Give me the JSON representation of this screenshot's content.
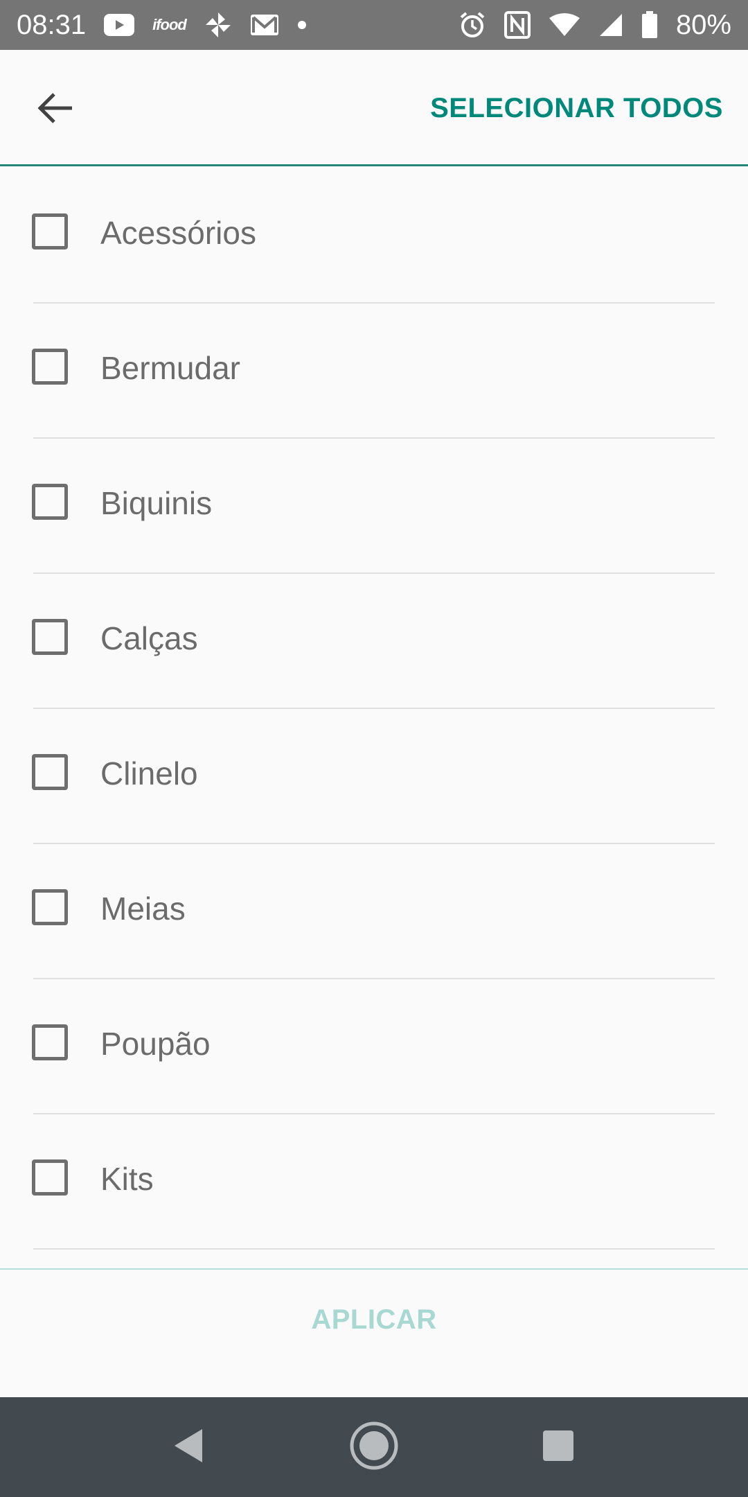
{
  "status_bar": {
    "time": "08:31",
    "battery": "80%",
    "notification_icons": [
      "youtube-icon",
      "ifood-icon",
      "pinwheel-icon",
      "gmail-icon",
      "dot-icon"
    ],
    "ifood_label": "ifood",
    "system_icons": [
      "alarm-icon",
      "nfc-icon",
      "wifi-icon",
      "signal-icon",
      "battery-icon"
    ]
  },
  "app_bar": {
    "back_icon": "arrow-left-icon",
    "select_all_label": "SELECIONAR TODOS",
    "accent_color": "#00897b"
  },
  "list": {
    "items": [
      {
        "label": "Acessórios",
        "checked": false
      },
      {
        "label": "Bermudar",
        "checked": false
      },
      {
        "label": "Biquinis",
        "checked": false
      },
      {
        "label": "Calças",
        "checked": false
      },
      {
        "label": "Clinelo",
        "checked": false
      },
      {
        "label": "Meias",
        "checked": false
      },
      {
        "label": "Poupão",
        "checked": false
      },
      {
        "label": "Kits",
        "checked": false
      }
    ]
  },
  "footer": {
    "apply_label": "APLICAR",
    "apply_color": "#a8d8d2"
  },
  "nav_bar": {
    "icons": [
      "nav-back-icon",
      "nav-home-icon",
      "nav-recents-icon"
    ]
  }
}
